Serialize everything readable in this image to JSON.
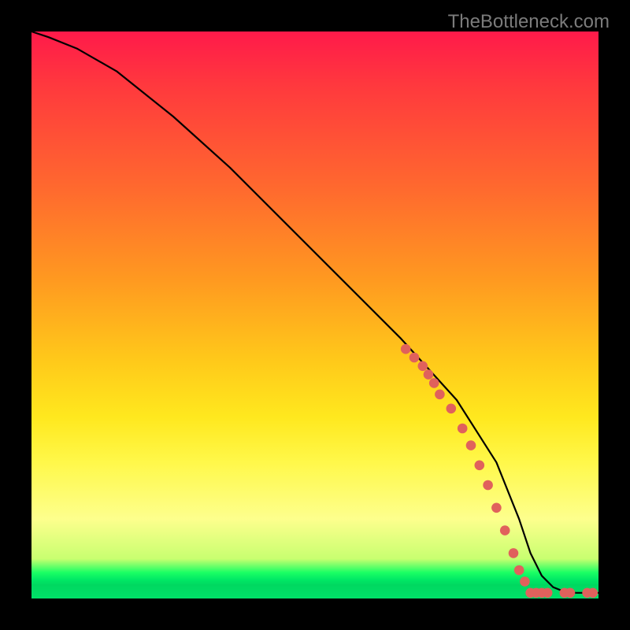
{
  "watermark": "TheBottleneck.com",
  "colors": {
    "bg": "#000000",
    "gradient_top": "#ff1a4a",
    "gradient_mid": "#ffe81e",
    "gradient_bottom": "#00e068",
    "curve": "#000000",
    "marker": "#e0615c"
  },
  "chart_data": {
    "type": "line",
    "title": "",
    "xlabel": "",
    "ylabel": "",
    "xlim": [
      0,
      100
    ],
    "ylim": [
      0,
      100
    ],
    "grid": false,
    "series": [
      {
        "name": "bottleneck-curve",
        "x": [
          0,
          3,
          8,
          15,
          25,
          35,
          45,
          55,
          65,
          75,
          82,
          86,
          88,
          90,
          92,
          94,
          96,
          98,
          100
        ],
        "y": [
          100,
          99,
          97,
          93,
          85,
          76,
          66,
          56,
          46,
          35,
          24,
          14,
          8,
          4,
          2,
          1.2,
          1,
          1,
          1
        ]
      }
    ],
    "markers": [
      {
        "name": "curve-dots",
        "x": [
          66,
          67.5,
          69,
          70,
          71,
          72,
          74,
          76,
          77.5,
          79,
          80.5,
          82,
          83.5,
          85,
          86,
          87
        ],
        "y": [
          44,
          42.5,
          41,
          39.5,
          38,
          36,
          33.5,
          30,
          27,
          23.5,
          20,
          16,
          12,
          8,
          5,
          3
        ]
      },
      {
        "name": "floor-dots",
        "x": [
          88,
          89,
          90,
          91,
          94,
          95,
          98,
          99
        ],
        "y": [
          1,
          1,
          1,
          1,
          1,
          1,
          1,
          1
        ]
      }
    ]
  }
}
